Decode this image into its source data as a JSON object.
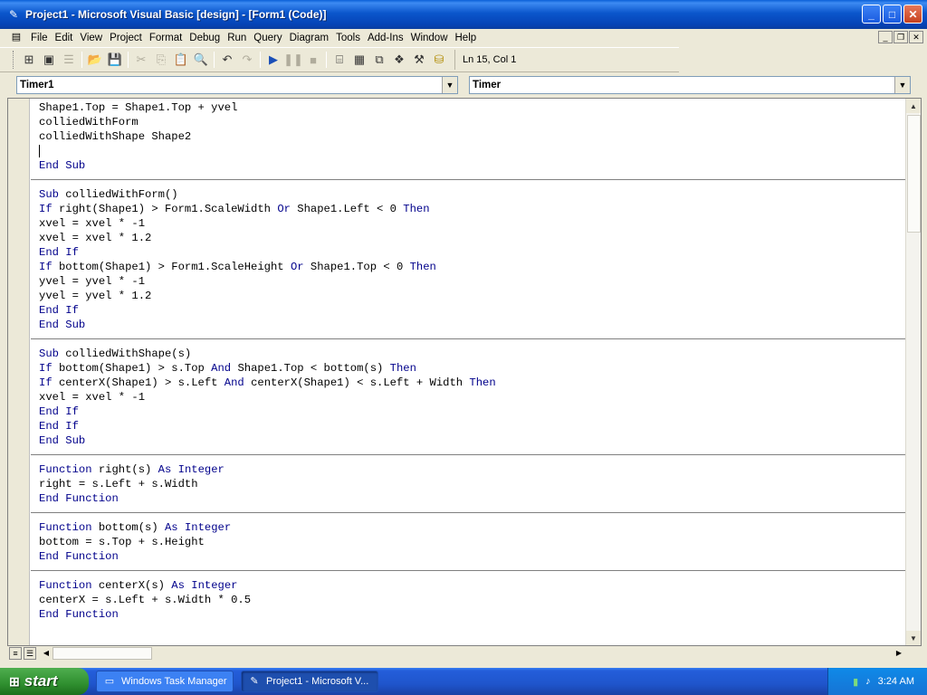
{
  "window": {
    "title": "Project1 - Microsoft Visual Basic [design] - [Form1 (Code)]",
    "controls": [
      "_",
      "□",
      "✕"
    ]
  },
  "menu": [
    "File",
    "Edit",
    "View",
    "Project",
    "Format",
    "Debug",
    "Run",
    "Query",
    "Diagram",
    "Tools",
    "Add-Ins",
    "Window",
    "Help"
  ],
  "toolbar": {
    "position": "Ln 15, Col 1"
  },
  "combos": {
    "object": "Timer1",
    "procedure": "Timer"
  },
  "code": {
    "blocks": [
      [
        "Shape1.Top = Shape1.Top + yvel",
        "colliedWithForm",
        "colliedWithShape Shape2",
        "",
        "End Sub"
      ],
      [
        "Sub colliedWithForm()",
        "If right(Shape1) > Form1.ScaleWidth Or Shape1.Left < 0 Then",
        "xvel = xvel * -1",
        "xvel = xvel * 1.2",
        "End If",
        "If bottom(Shape1) > Form1.ScaleHeight Or Shape1.Top < 0 Then",
        "yvel = yvel * -1",
        "yvel = yvel * 1.2",
        "End If",
        "End Sub"
      ],
      [
        "Sub colliedWithShape(s)",
        "If bottom(Shape1) > s.Top And Shape1.Top < bottom(s) Then",
        "If centerX(Shape1) > s.Left And centerX(Shape1) < s.Left + Width Then",
        "xvel = xvel * -1",
        "End If",
        "End If",
        "End Sub"
      ],
      [
        "Function right(s) As Integer",
        "right = s.Left + s.Width",
        "End Function"
      ],
      [
        "Function bottom(s) As Integer",
        "bottom = s.Top + s.Height",
        "End Function"
      ],
      [
        "Function centerX(s) As Integer",
        "centerX = s.Left + s.Width * 0.5",
        "End Function"
      ]
    ]
  },
  "taskbar": {
    "start": "start",
    "tasks": [
      "Windows Task Manager",
      "Project1 - Microsoft V..."
    ],
    "clock": "3:24 AM"
  }
}
